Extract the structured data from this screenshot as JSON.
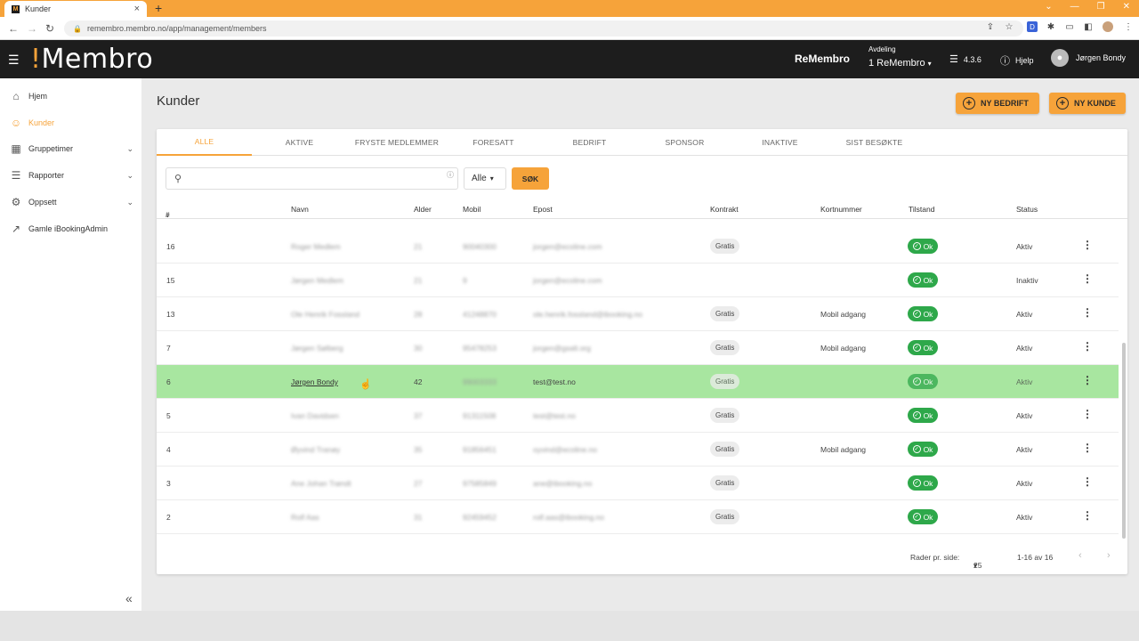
{
  "browser": {
    "tab_title": "Kunder",
    "tab_favicon": "M",
    "url": "remembro.membro.no/app/management/members"
  },
  "header": {
    "logo_bang": "!",
    "logo_text": "Membro",
    "brand": "ReMembro",
    "dept_label": "Avdeling",
    "dept_value": "1 ReMembro",
    "version": "4.3.6",
    "help": "Hjelp",
    "user": "Jørgen Bondy"
  },
  "sidebar": {
    "items": [
      {
        "label": "Hjem",
        "icon": "home-icon"
      },
      {
        "label": "Kunder",
        "icon": "people-icon"
      },
      {
        "label": "Gruppetimer",
        "icon": "calendar-icon"
      },
      {
        "label": "Rapporter",
        "icon": "list-icon"
      },
      {
        "label": "Oppsett",
        "icon": "gear-icon"
      },
      {
        "label": "Gamle iBookingAdmin",
        "icon": "external-link-icon"
      }
    ]
  },
  "page": {
    "title": "Kunder",
    "btn_company": "NY BEDRIFT",
    "btn_customer": "NY KUNDE"
  },
  "tabs": [
    "ALLE",
    "AKTIVE",
    "FRYSTE MEDLEMMER",
    "FORESATT",
    "BEDRIFT",
    "SPONSOR",
    "INAKTIVE",
    "SIST BESØKTE"
  ],
  "filter": {
    "select_value": "Alle",
    "search_button": "SØK"
  },
  "columns": {
    "num": "#",
    "name": "Navn",
    "age": "Alder",
    "mobile": "Mobil",
    "email": "Epost",
    "contract": "Kontrakt",
    "cardnum": "Kortnummer",
    "state": "Tilstand",
    "status": "Status"
  },
  "rows": [
    {
      "num": "16",
      "name": "Roger Medlem",
      "age": "21",
      "mobile": "90040300",
      "email": "jorgen@ecoline.com",
      "contract": "Gratis",
      "card": "",
      "state": "Ok",
      "status": "Aktiv"
    },
    {
      "num": "15",
      "name": "Jørgen Medlem",
      "age": "21",
      "mobile": "9",
      "email": "jorgen@ecoline.com",
      "contract": "",
      "card": "",
      "state": "Ok",
      "status": "Inaktiv"
    },
    {
      "num": "13",
      "name": "Ole Henrik Fossland",
      "age": "28",
      "mobile": "41248870",
      "email": "ole.henrik.fossland@ibooking.no",
      "contract": "Gratis",
      "card": "Mobil adgang",
      "state": "Ok",
      "status": "Aktiv"
    },
    {
      "num": "7",
      "name": "Jørgen Sølberg",
      "age": "30",
      "mobile": "95478253",
      "email": "jorgen@gsalt.org",
      "contract": "Gratis",
      "card": "Mobil adgang",
      "state": "Ok",
      "status": "Aktiv"
    },
    {
      "num": "6",
      "name": "Jørgen Bondy",
      "age": "42",
      "mobile": "99003333",
      "email": "test@test.no",
      "contract": "Gratis",
      "card": "",
      "state": "Ok",
      "status": "Aktiv"
    },
    {
      "num": "5",
      "name": "Ivan Davidsen",
      "age": "37",
      "mobile": "91311508",
      "email": "test@test.no",
      "contract": "Gratis",
      "card": "",
      "state": "Ok",
      "status": "Aktiv"
    },
    {
      "num": "4",
      "name": "Øyvind Tranøy",
      "age": "35",
      "mobile": "91856451",
      "email": "oyvind@ecoline.no",
      "contract": "Gratis",
      "card": "Mobil adgang",
      "state": "Ok",
      "status": "Aktiv"
    },
    {
      "num": "3",
      "name": "Ane Johan Trøndt",
      "age": "27",
      "mobile": "97585849",
      "email": "ane@ibooking.no",
      "contract": "Gratis",
      "card": "",
      "state": "Ok",
      "status": "Aktiv"
    },
    {
      "num": "2",
      "name": "Rolf Aas",
      "age": "31",
      "mobile": "92459452",
      "email": "rolf.aas@ibooking.no",
      "contract": "Gratis",
      "card": "",
      "state": "Ok",
      "status": "Aktiv"
    }
  ],
  "footer": {
    "rows_label": "Rader pr. side:",
    "rows_value": "25",
    "range": "1-16 av 16"
  }
}
